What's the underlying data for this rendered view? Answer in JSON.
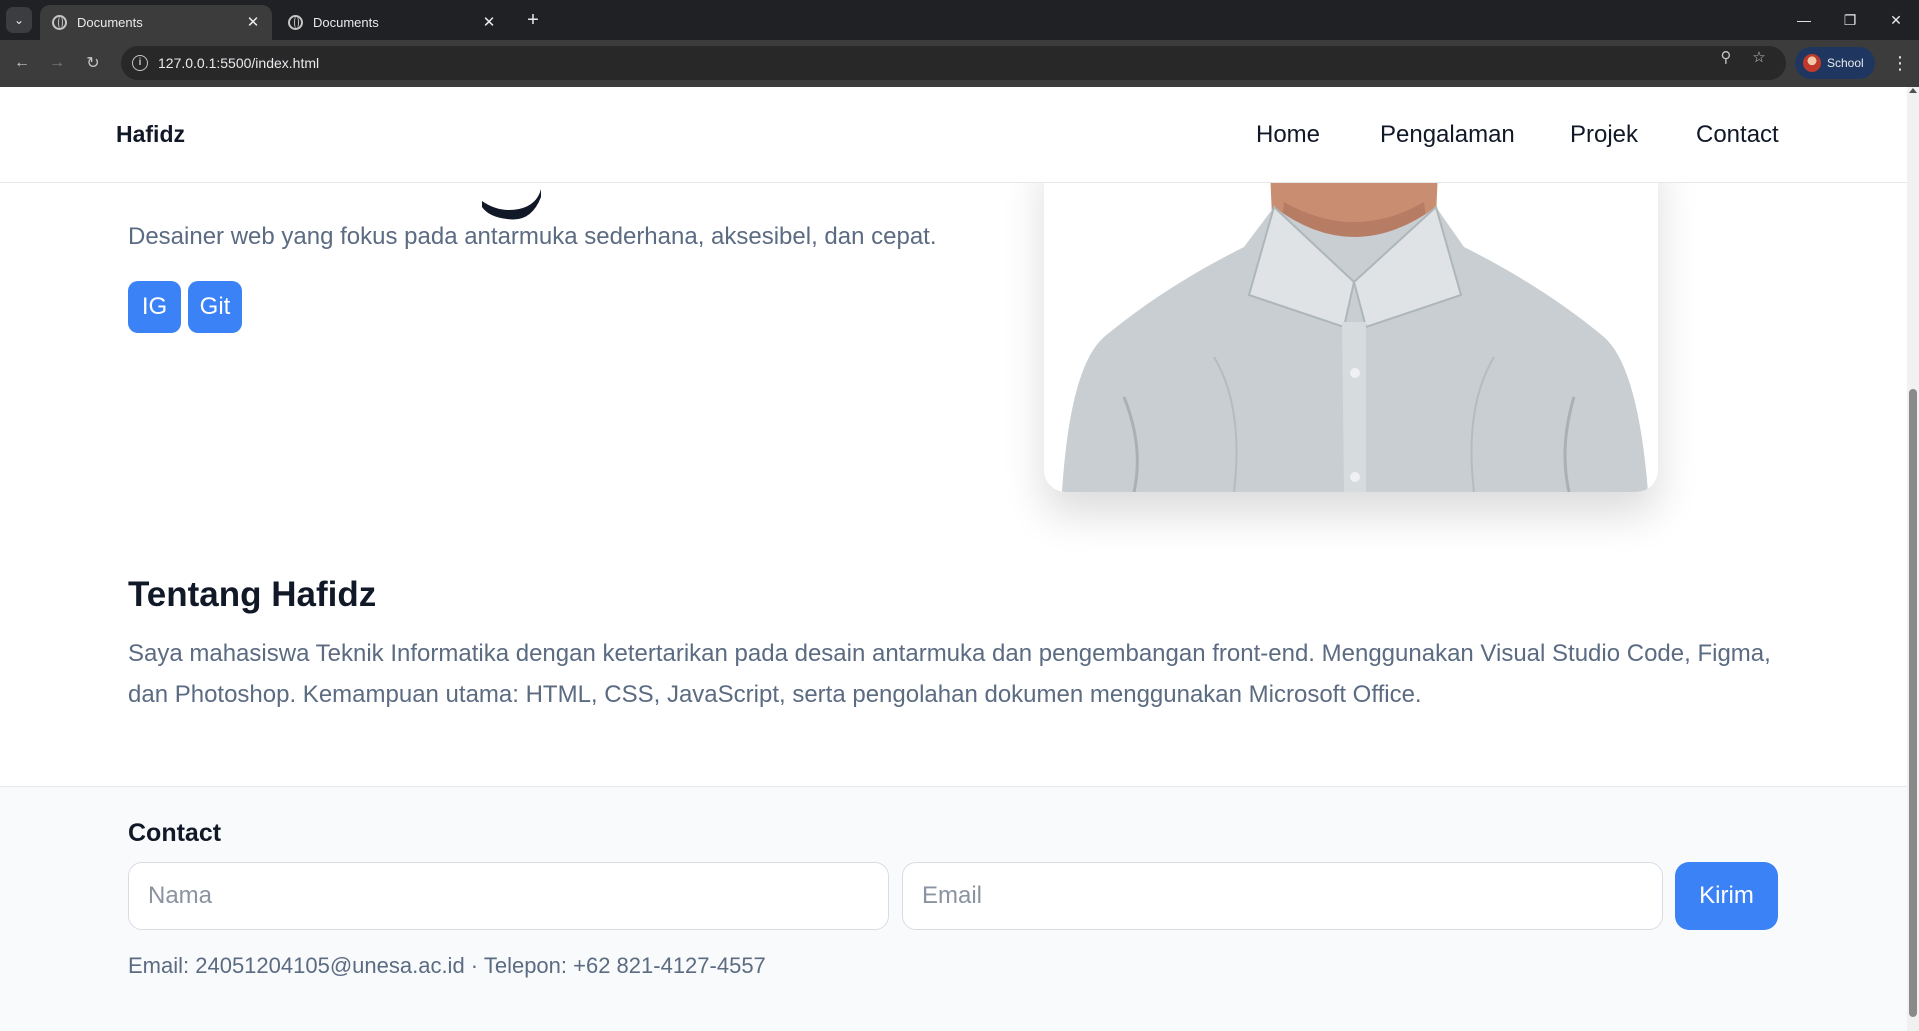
{
  "browser": {
    "tabs": [
      {
        "title": "Documents",
        "active": true
      },
      {
        "title": "Documents",
        "active": false
      }
    ],
    "url": "127.0.0.1:5500/index.html",
    "profile_label": "School",
    "icons": [
      "tab-search-icon",
      "globe-icon",
      "close-icon",
      "plus-icon",
      "minimize-icon",
      "restore-icon",
      "back-arrow-icon",
      "forward-arrow-icon",
      "reload-icon",
      "site-info-icon",
      "zoom-icon",
      "star-icon",
      "kebab-menu-icon"
    ]
  },
  "navbar": {
    "brand": "Hafidz",
    "links": [
      "Home",
      "Pengalaman",
      "Projek",
      "Contact"
    ]
  },
  "hero": {
    "subtitle": "Desainer web yang fokus pada antarmuka sederhana, aksesibel, dan cepat.",
    "buttons": [
      "IG",
      "Git"
    ],
    "accent": "#3b82f6"
  },
  "about": {
    "title": "Tentang Hafidz",
    "text": "Saya mahasiswa Teknik Informatika dengan ketertarikan pada desain antarmuka dan pengembangan front-end. Menggunakan Visual Studio Code, Figma, dan Photoshop. Kemampuan utama: HTML, CSS, JavaScript, serta pengolahan dokumen menggunakan Microsoft Office."
  },
  "contact": {
    "title": "Contact",
    "name_placeholder": "Nama",
    "email_placeholder": "Email",
    "submit_label": "Kirim",
    "info": "Email: 24051204105@unesa.ac.id · Telepon: +62 821-4127-4557"
  }
}
